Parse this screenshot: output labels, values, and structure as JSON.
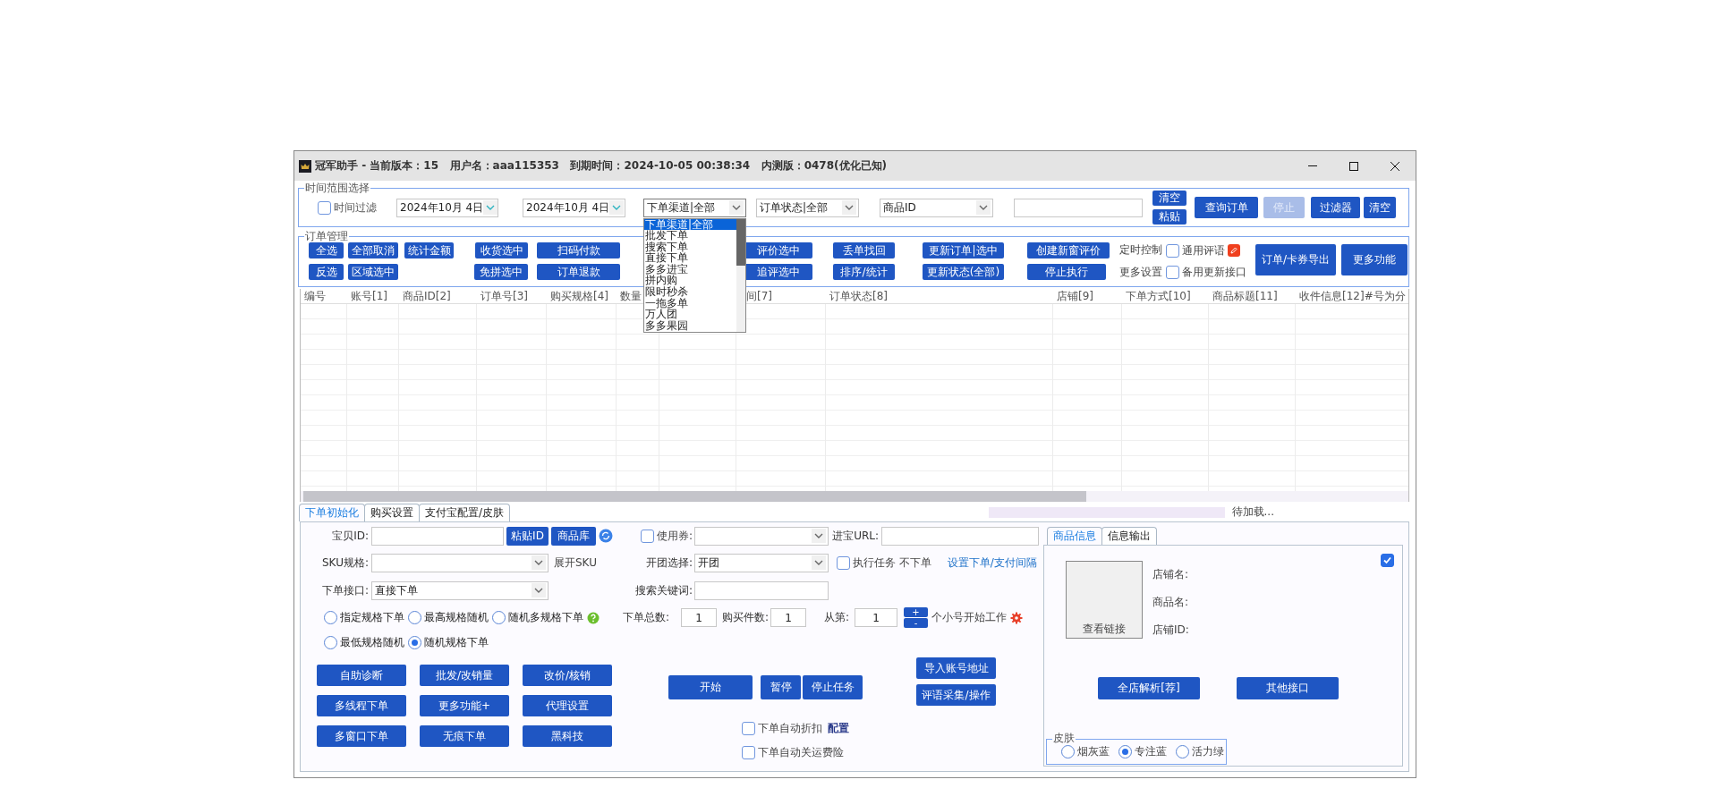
{
  "window": {
    "title": "冠军助手 - 当前版本：15   用户名：aaa115353   到期时间：2024-10-05 00:38:34   内测版：0478(优化已知)"
  },
  "time_filter": {
    "legend": "时间范围选择",
    "checkbox": {
      "label": "时间过滤",
      "checked": false
    },
    "start_date": "2024年10月 4日",
    "end_date": "2024年10月 4日",
    "channel": {
      "value": "下单渠道|全部",
      "expanded": true,
      "options": [
        {
          "label": "下单渠道|全部",
          "selected": true
        },
        {
          "label": "批发下单",
          "selected": false
        },
        {
          "label": "搜索下单",
          "selected": false
        },
        {
          "label": "直接下单",
          "selected": false
        },
        {
          "label": "多多进宝",
          "selected": false
        },
        {
          "label": "拼内购",
          "selected": false
        },
        {
          "label": "限时秒杀",
          "selected": false
        },
        {
          "label": "一拖多单",
          "selected": false
        },
        {
          "label": "万人团",
          "selected": false
        },
        {
          "label": "多多果园",
          "selected": false
        }
      ]
    },
    "order_status": "订单状态|全部",
    "field_select": "商品ID",
    "small_buttons": [
      "清空",
      "粘贴"
    ],
    "buttons": [
      {
        "label": "查询订单",
        "disabled": false
      },
      {
        "label": "停止",
        "disabled": true
      },
      {
        "label": "过滤器",
        "disabled": false
      },
      {
        "label": "清空",
        "disabled": false
      }
    ]
  },
  "order_management": {
    "legend": "订单管理",
    "button_columns": [
      [
        "全选",
        "反选"
      ],
      [
        "全部取消",
        "区域选中"
      ],
      [
        "统计金额"
      ],
      [
        "收货选中",
        "免拼选中"
      ],
      [
        "扫码付款",
        "订单退款"
      ],
      [
        "评价选中",
        "追评选中"
      ],
      [
        "丢单找回",
        "排序/统计"
      ],
      [
        "更新订单|选中",
        "更新状态(全部)"
      ],
      [
        "创建新窗评价",
        "停止执行"
      ]
    ],
    "labels": [
      "定时控制",
      "更多设置"
    ],
    "checkboxes": [
      {
        "label": "通用评语",
        "checked": false
      },
      {
        "label": "备用更新接口",
        "checked": false
      }
    ],
    "big_buttons": [
      "订单/卡券导出",
      "更多功能"
    ]
  },
  "table": {
    "columns": [
      "编号",
      "账号[1]",
      "商品ID[2]",
      "订单号[3]",
      "购买规格[4]",
      "数量",
      "间[7]",
      "订单状态[8]",
      "店铺[9]",
      "下单方式[10]",
      "商品标题[11]",
      "收件信息[12]#号为分"
    ]
  },
  "tabs": [
    {
      "label": "下单初始化",
      "selected": true
    },
    {
      "label": "购买设置",
      "selected": false
    },
    {
      "label": "支付宝配置/皮肤",
      "selected": false
    }
  ],
  "progress": {
    "level": 0
  },
  "status": "待加载...",
  "order_form": {
    "item_id": {
      "label": "宝贝ID:",
      "buttons": [
        "粘贴ID",
        "商品库"
      ]
    },
    "coupon": {
      "label": "使用券:",
      "checked": false
    },
    "url": {
      "label": "进宝URL:"
    },
    "sku": {
      "label": "SKU规格:",
      "expand": "展开SKU"
    },
    "group_select": {
      "label": "开团选择:",
      "value": "开团"
    },
    "execute": {
      "label": "执行任务 不下单",
      "checked": false
    },
    "interval_link": "设置下单/支付间隔",
    "api": {
      "label": "下单接口:",
      "value": "直接下单"
    },
    "keyword": {
      "label": "搜索关键词:"
    },
    "spec_modes": [
      {
        "label": "指定规格下单",
        "selected": false
      },
      {
        "label": "最高规格随机",
        "selected": false
      },
      {
        "label": "随机多规格下单",
        "selected": false
      },
      {
        "label": "最低规格随机",
        "selected": false
      },
      {
        "label": "随机规格下单",
        "selected": true
      }
    ],
    "counts": [
      {
        "label": "下单总数:",
        "value": "1"
      },
      {
        "label": "购买件数:",
        "value": "1"
      },
      {
        "label": "从第:",
        "value": "1"
      }
    ],
    "stepper": [
      "+",
      "-"
    ],
    "start_suffix": "个小号开始工作",
    "tool_buttons": [
      "自助诊断",
      "批发/改销量",
      "改价/核销",
      "多线程下单",
      "更多功能+",
      "代理设置",
      "多窗口下单",
      "无痕下单",
      "黑科技"
    ],
    "run_buttons": [
      "开始",
      "暂停",
      "停止任务"
    ],
    "side_buttons": [
      "导入账号地址",
      "评语采集/操作"
    ],
    "auto_options": [
      {
        "label": "下单自动折扣",
        "checked": false,
        "link": "配置"
      },
      {
        "label": "下单自动关运费险",
        "checked": false
      }
    ]
  },
  "info_panel": {
    "tabs": [
      {
        "label": "商品信息",
        "selected": true
      },
      {
        "label": "信息输出",
        "selected": false
      }
    ],
    "enabled": {
      "checked": true
    },
    "image_link": "查看链接",
    "fields": [
      "店铺名:",
      "商品名:",
      "店铺ID:"
    ],
    "buttons": [
      "全店解析[荐]",
      "其他接口"
    ],
    "skin": {
      "legend": "皮肤",
      "options": [
        {
          "label": "烟灰蓝",
          "selected": false
        },
        {
          "label": "专注蓝",
          "selected": true
        },
        {
          "label": "活力绿",
          "selected": false
        }
      ]
    }
  }
}
